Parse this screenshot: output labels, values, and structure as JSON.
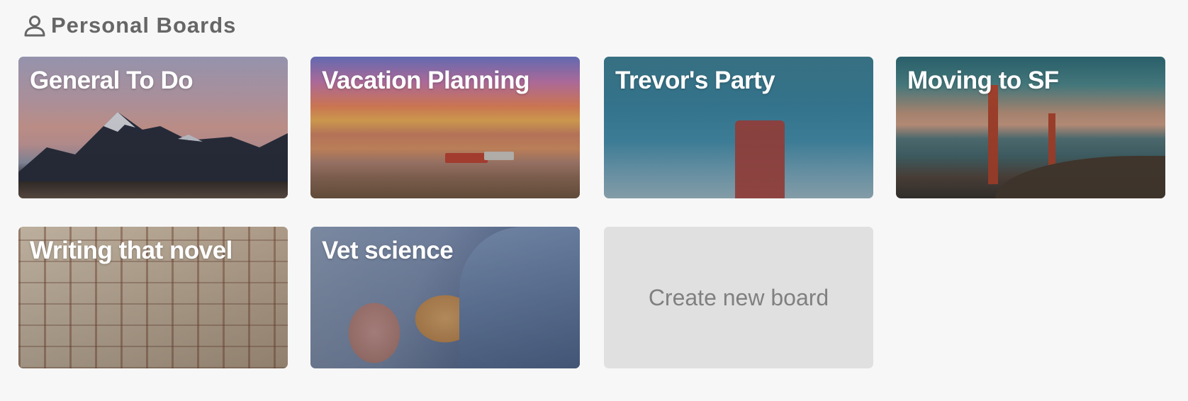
{
  "section": {
    "title": "Personal Boards",
    "icon": "user-icon"
  },
  "boards": [
    {
      "title": "General To Do"
    },
    {
      "title": "Vacation Planning"
    },
    {
      "title": "Trevor's Party"
    },
    {
      "title": "Moving to SF"
    },
    {
      "title": "Writing that novel"
    },
    {
      "title": "Vet science"
    }
  ],
  "create_board": {
    "label": "Create new board"
  }
}
